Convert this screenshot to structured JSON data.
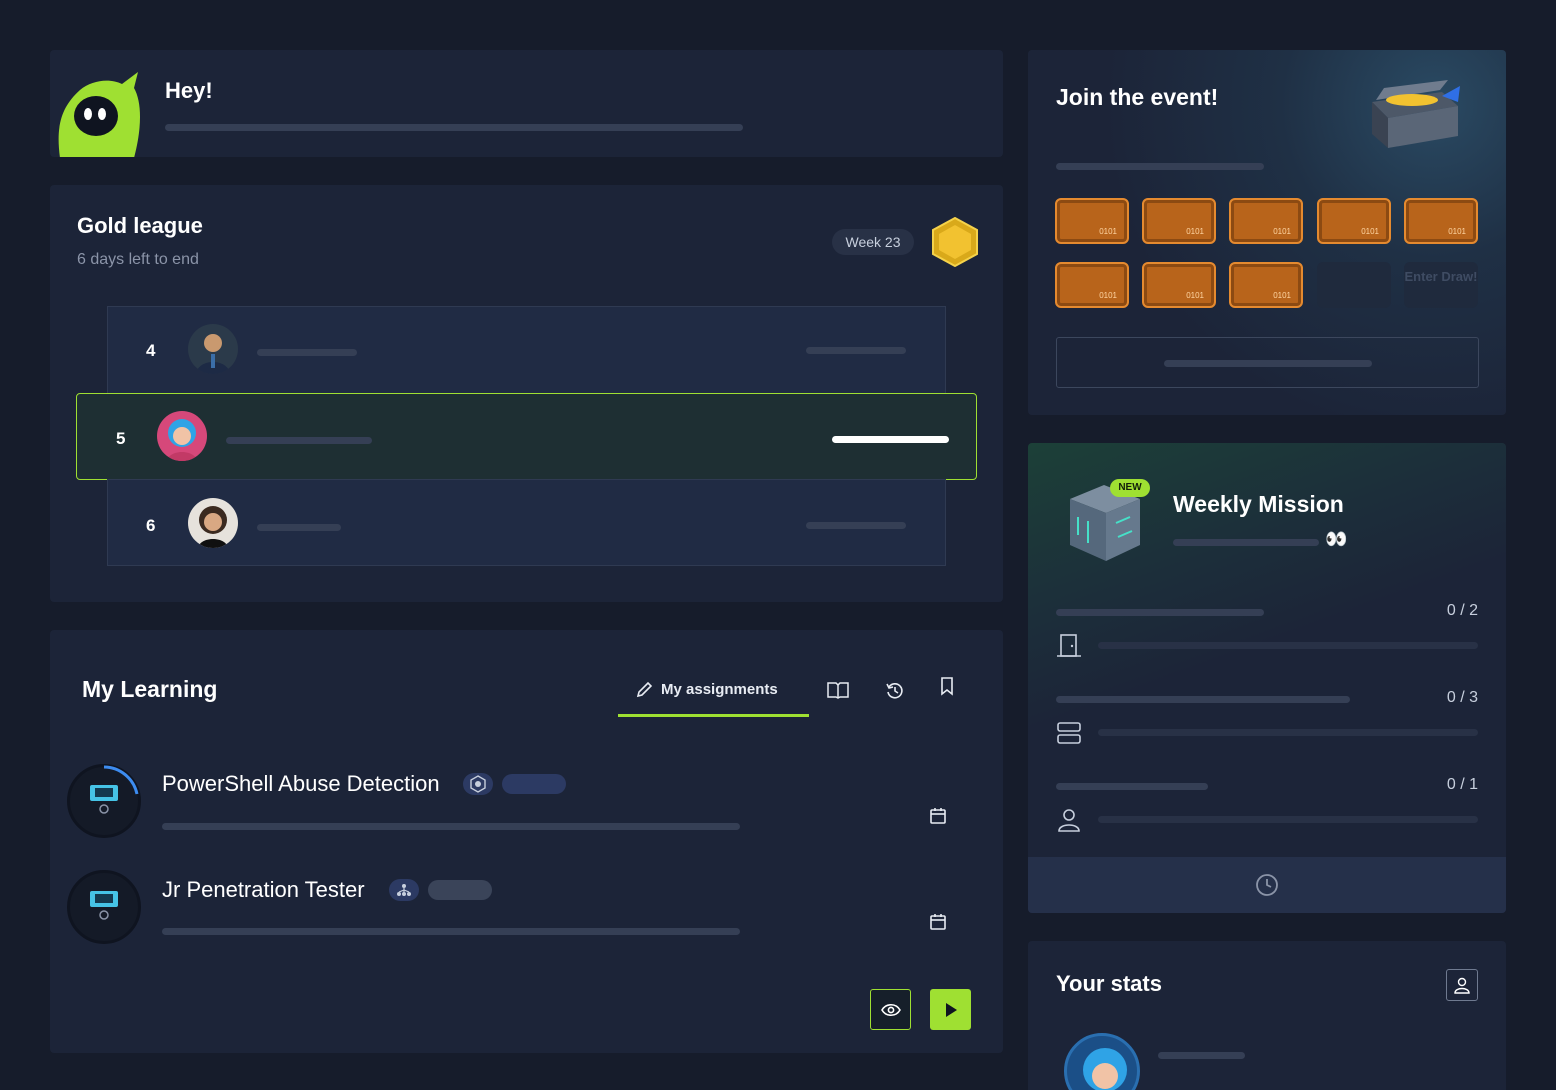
{
  "greeting": {
    "title": "Hey!",
    "mascot_icon": "hooded-mascot-icon"
  },
  "league": {
    "title": "Gold league",
    "subtitle": "6 days left to end",
    "week_label": "Week 23",
    "medal_icon": "gold-hexagon-medal-icon",
    "rows": [
      {
        "rank": "4",
        "highlight": false
      },
      {
        "rank": "5",
        "highlight": true
      },
      {
        "rank": "6",
        "highlight": false
      }
    ]
  },
  "learning": {
    "title": "My Learning",
    "tabs": [
      {
        "label": "My assignments",
        "icon": "pencil-icon",
        "active": true
      },
      {
        "label": "",
        "icon": "book-icon",
        "active": false
      },
      {
        "label": "",
        "icon": "history-icon",
        "active": false
      },
      {
        "label": "",
        "icon": "bookmark-icon",
        "active": false
      }
    ],
    "courses": [
      {
        "title": "PowerShell Abuse Detection",
        "badge_icon": "module-icon",
        "calendar_icon": "calendar-icon"
      },
      {
        "title": "Jr Penetration Tester",
        "badge_icon": "path-icon",
        "calendar_icon": "calendar-icon"
      }
    ],
    "actions": {
      "view_icon": "eye-icon",
      "play_icon": "play-icon"
    }
  },
  "event": {
    "title": "Join the event!",
    "chest_icon": "treasure-chest-icon",
    "ticket_text": "0101",
    "enter_draw_label": "Enter Draw!"
  },
  "mission": {
    "title": "Weekly Mission",
    "new_badge": "NEW",
    "eyes_emoji": "👀",
    "tasks": [
      {
        "count": "0 / 2",
        "icon": "door-icon"
      },
      {
        "count": "0 / 3",
        "icon": "server-icon"
      },
      {
        "count": "0 / 1",
        "icon": "user-icon"
      }
    ],
    "footer_icon": "clock-icon"
  },
  "stats": {
    "title": "Your stats",
    "user_icon": "user-icon"
  },
  "colors": {
    "accent": "#9fe032",
    "background": "#161c2b",
    "card": "#1c2438"
  }
}
